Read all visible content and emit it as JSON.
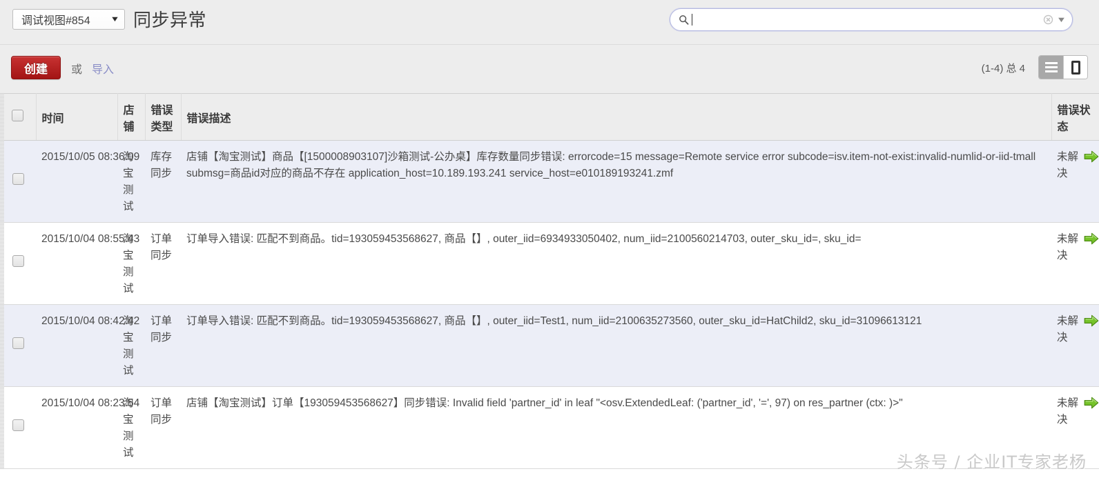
{
  "topbar": {
    "view_selector_label": "调试视图#854",
    "view_selector_caret": "▼",
    "page_title": "同步异常",
    "search": {
      "value": "",
      "placeholder": "",
      "magnifier_icon": "search-icon",
      "clear_icon": "clear-icon",
      "dropdown_caret": "▼"
    }
  },
  "actionbar": {
    "create_label": "创建",
    "or_label": "或",
    "import_label": "导入",
    "pager_label": "(1-4) 总 4",
    "view_list_icon": "list-view-icon",
    "view_form_icon": "form-view-icon"
  },
  "table": {
    "headers": {
      "select_all": "",
      "time": "时间",
      "shop": "店铺",
      "error_type": "错误类型",
      "error_desc": "错误描述",
      "error_status": "错误状态"
    },
    "rows": [
      {
        "time": "2015/10/05 08:36:09",
        "shop": "淘宝测试",
        "error_type": "库存同步",
        "error_desc": "店铺【淘宝测试】商品【[1500008903107]沙箱测试-公办桌】库存数量同步错误: errorcode=15 message=Remote service error subcode=isv.item-not-exist:invalid-numlid-or-iid-tmall submsg=商品id对应的商品不存在 application_host=10.189.193.241 service_host=e010189193241.zmf",
        "error_status": "未解决",
        "arrow_icon": "green-arrow-right-icon"
      },
      {
        "time": "2015/10/04 08:55:43",
        "shop": "淘宝测试",
        "error_type": "订单同步",
        "error_desc": "订单导入错误: 匹配不到商品。tid=193059453568627, 商品【】, outer_iid=6934933050402, num_iid=2100560214703, outer_sku_id=, sku_id=",
        "error_status": "未解决",
        "arrow_icon": "green-arrow-right-icon"
      },
      {
        "time": "2015/10/04 08:42:42",
        "shop": "淘宝测试",
        "error_type": "订单同步",
        "error_desc": "订单导入错误: 匹配不到商品。tid=193059453568627, 商品【】, outer_iid=Test1, num_iid=2100635273560, outer_sku_id=HatChild2, sku_id=31096613121",
        "error_status": "未解决",
        "arrow_icon": "green-arrow-right-icon"
      },
      {
        "time": "2015/10/04 08:23:54",
        "shop": "淘宝测试",
        "error_type": "订单同步",
        "error_desc": "店铺【淘宝测试】订单【193059453568627】同步错误: Invalid field 'partner_id' in leaf \"<osv.ExtendedLeaf: ('partner_id', '=', 97) on res_partner (ctx: )>\"",
        "error_status": "未解决",
        "arrow_icon": "green-arrow-right-icon"
      }
    ]
  },
  "watermark": "头条号 / 企业IT专家老杨",
  "colors": {
    "create_button": "#a31414",
    "import_link": "#8a8ec7",
    "row_odd_background": "#eceef7",
    "chrome_background": "#ededed",
    "status_arrow": "#6fbf1f"
  }
}
